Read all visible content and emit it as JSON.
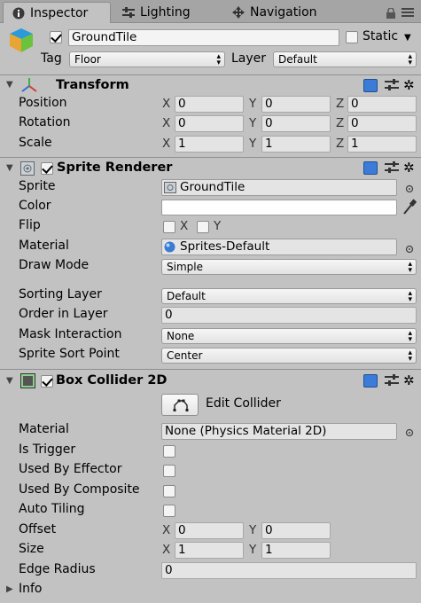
{
  "tabs": {
    "inspector": "Inspector",
    "lighting": "Lighting",
    "navigation": "Navigation"
  },
  "gameobject": {
    "name": "GroundTile",
    "active": true,
    "static_label": "Static",
    "static_checked": false,
    "tag_label": "Tag",
    "tag_value": "Floor",
    "layer_label": "Layer",
    "layer_value": "Default"
  },
  "transform": {
    "title": "Transform",
    "position_label": "Position",
    "rotation_label": "Rotation",
    "scale_label": "Scale",
    "axis_x": "X",
    "axis_y": "Y",
    "axis_z": "Z",
    "position": {
      "x": "0",
      "y": "0",
      "z": "0"
    },
    "rotation": {
      "x": "0",
      "y": "0",
      "z": "0"
    },
    "scale": {
      "x": "1",
      "y": "1",
      "z": "1"
    }
  },
  "sprite_renderer": {
    "title": "Sprite Renderer",
    "enabled": true,
    "sprite_label": "Sprite",
    "sprite_value": "GroundTile",
    "color_label": "Color",
    "color_value": "#ffffff",
    "flip_label": "Flip",
    "flip_x": "X",
    "flip_y": "Y",
    "material_label": "Material",
    "material_value": "Sprites-Default",
    "draw_mode_label": "Draw Mode",
    "draw_mode_value": "Simple",
    "sorting_layer_label": "Sorting Layer",
    "sorting_layer_value": "Default",
    "order_label": "Order in Layer",
    "order_value": "0",
    "mask_label": "Mask Interaction",
    "mask_value": "None",
    "sort_point_label": "Sprite Sort Point",
    "sort_point_value": "Center"
  },
  "box_collider": {
    "title": "Box Collider 2D",
    "enabled": true,
    "edit_collider_label": "Edit Collider",
    "material_label": "Material",
    "material_value": "None (Physics Material 2D)",
    "is_trigger_label": "Is Trigger",
    "used_by_effector_label": "Used By Effector",
    "used_by_composite_label": "Used By Composite",
    "auto_tiling_label": "Auto Tiling",
    "offset_label": "Offset",
    "size_label": "Size",
    "edge_radius_label": "Edge Radius",
    "info_label": "Info",
    "axis_x": "X",
    "axis_y": "Y",
    "offset": {
      "x": "0",
      "y": "0"
    },
    "size": {
      "x": "1",
      "y": "1"
    },
    "edge_radius_value": "0"
  },
  "colors": {
    "panel_bg": "#c2c2c2",
    "tabbar_bg": "#a5a5a5",
    "help_icon": "#3d7bd9"
  },
  "icons": [
    "info-icon",
    "lighting-icon",
    "navigation-icon",
    "lock-icon",
    "menu-icon",
    "cube-icon",
    "transform-icon",
    "sprite-renderer-icon",
    "box-collider-icon",
    "help-icon",
    "preset-icon",
    "gear-icon",
    "object-picker-icon",
    "eyedropper-icon",
    "edit-collider-icon"
  ]
}
